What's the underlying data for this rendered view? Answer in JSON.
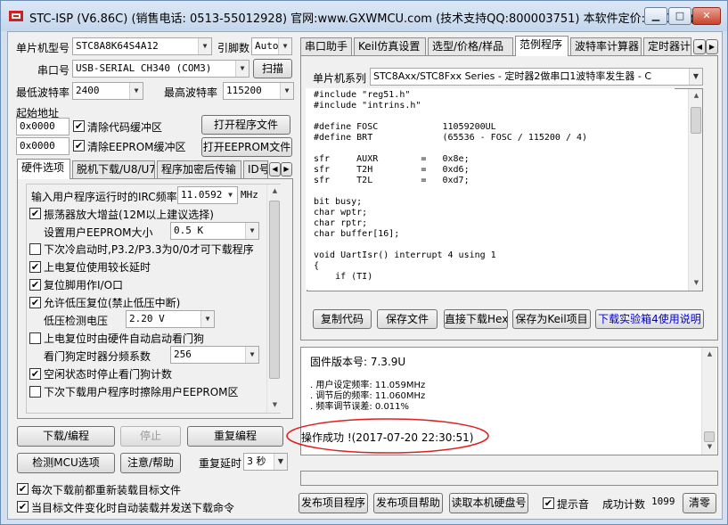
{
  "window": {
    "title": "STC-ISP (V6.86C) (销售电话: 0513-55012928) 官网:www.GXWMCU.com (技术支持QQ:800003751) 本软件定价: 6000元(..."
  },
  "left": {
    "mcu_type_label": "单片机型号",
    "mcu_type_value": "STC8A8K64S4A12",
    "pin_count_label": "引脚数",
    "pin_count_value": "Auto",
    "port_label": "串口号",
    "port_value": "USB-SERIAL CH340 (COM3)",
    "scan_button": "扫描",
    "min_baud_label": "最低波特率",
    "min_baud_value": "2400",
    "max_baud_label": "最高波特率",
    "max_baud_value": "115200",
    "start_addr_label": "起始地址",
    "code_addr_value": "0x0000",
    "clear_code_label": "清除代码缓冲区",
    "clear_code_checked": true,
    "open_program_button": "打开程序文件",
    "eeprom_addr_value": "0x0000",
    "clear_eeprom_label": "清除EEPROM缓冲区",
    "clear_eeprom_checked": true,
    "open_eeprom_button": "打开EEPROM文件"
  },
  "hw_tabs": [
    "硬件选项",
    "脱机下载/U8/U7",
    "程序加密后传输",
    "ID号"
  ],
  "hw_options": {
    "irc_label": "输入用户程序运行时的IRC频率",
    "irc_value": "11.0592",
    "irc_unit": "MHz",
    "osc_gain_label": "振荡器放大增益(12M以上建议选择)",
    "osc_gain_checked": true,
    "eeprom_size_label": "设置用户EEPROM大小",
    "eeprom_size_value": "0.5 K",
    "cold_boot_label": "下次冷启动时,P3.2/P3.3为0/0才可下载程序",
    "cold_boot_checked": false,
    "long_reset_label": "上电复位使用较长延时",
    "long_reset_checked": true,
    "reset_pin_label": "复位脚用作I/O口",
    "reset_pin_checked": true,
    "lvr_label": "允许低压复位(禁止低压中断)",
    "lvr_checked": true,
    "lv_detect_label": "低压检测电压",
    "lv_detect_value": "2.20 V",
    "wdt_hw_label": "上电复位时由硬件自动启动看门狗",
    "wdt_hw_checked": false,
    "wdt_div_label": "看门狗定时器分频系数",
    "wdt_div_value": "256",
    "idle_wdt_label": "空闲状态时停止看门狗计数",
    "idle_wdt_checked": true,
    "erase_eeprom_label": "下次下载用户程序时擦除用户EEPROM区",
    "erase_eeprom_checked": false
  },
  "actions": {
    "download_button": "下载/编程",
    "stop_button": "停止",
    "reprogram_button": "重复编程",
    "detect_button": "检测MCU选项",
    "help_button": "注意/帮助",
    "repeat_delay_label": "重复延时",
    "repeat_delay_value": "3 秒",
    "reload_label": "每次下载前都重新装载目标文件",
    "reload_checked": true,
    "auto_send_label": "当目标文件变化时自动装载并发送下载命令",
    "auto_send_checked": true
  },
  "right_tabs": [
    "串口助手",
    "Keil仿真设置",
    "选型/价格/样品",
    "范例程序",
    "波特率计算器",
    "定时器计"
  ],
  "examples": {
    "series_label": "单片机系列",
    "series_value": "STC8Axx/STC8Fxx Series - 定时器2做串口1波特率发生器 - C",
    "code": "#include \"reg51.h\"\n#include \"intrins.h\"\n\n#define FOSC            11059200UL\n#define BRT             (65536 - FOSC / 115200 / 4)\n\nsfr     AUXR        =   0x8e;\nsfr     T2H         =   0xd6;\nsfr     T2L         =   0xd7;\n\nbit busy;\nchar wptr;\nchar rptr;\nchar buffer[16];\n\nvoid UartIsr() interrupt 4 using 1\n{\n    if (TI)",
    "copy_button": "复制代码",
    "save_button": "保存文件",
    "download_hex_button": "直接下载Hex",
    "save_keil_button": "保存为Keil项目",
    "manual_link": "下载实验箱4使用说明"
  },
  "log": {
    "firmware": "固件版本号: 7.3.9U",
    "line1": ". 用户设定频率: 11.059MHz",
    "line2": ". 调节后的频率: 11.060MHz",
    "line3": ". 频率调节误差: 0.011%",
    "success": "操作成功 !(2017-07-20 22:30:51)"
  },
  "bottom": {
    "publish_program_button": "发布项目程序",
    "publish_help_button": "发布项目帮助",
    "read_disk_button": "读取本机硬盘号",
    "sound_label": "提示音",
    "sound_checked": true,
    "success_count_label": "成功计数",
    "success_count_value": "1099",
    "clear_button": "清零"
  },
  "colors": {
    "annotation_ellipse": "#e02020",
    "link_color": "#0000cc"
  }
}
